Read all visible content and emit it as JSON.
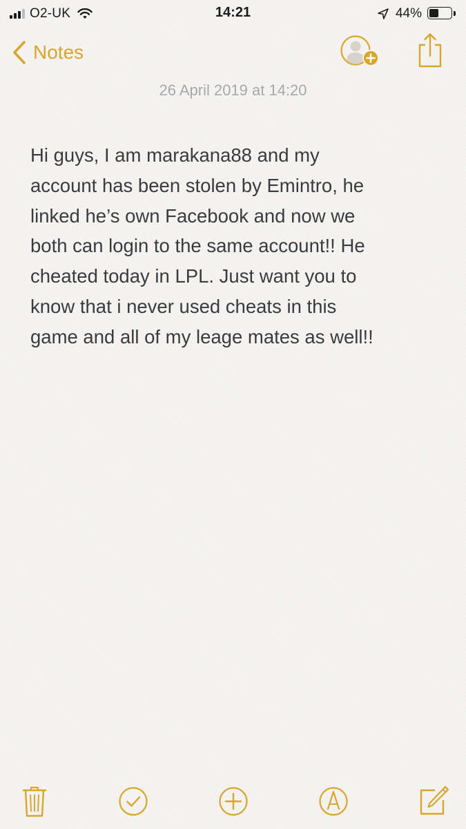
{
  "status_bar": {
    "carrier": "O2-UK",
    "time": "14:21",
    "battery_percent_label": "44%",
    "battery_level": 0.44,
    "icons": [
      "signal-bars-icon",
      "wifi-icon",
      "location-arrow-icon",
      "battery-icon"
    ]
  },
  "nav": {
    "back_label": "Notes",
    "actions": [
      "add-people-icon",
      "share-icon"
    ]
  },
  "note": {
    "date": "26 April 2019 at 14:20",
    "body": "Hi guys, I am marakana88 and my\naccount has been stolen by Emintro, he\nlinked he’s own Facebook and now we\nboth can login to the same account!! He\ncheated today in LPL. Just want you to\nknow that i never used cheats in this\ngame and all of my leage mates as well!!"
  },
  "toolbar": {
    "items": [
      "trash-icon",
      "checklist-icon",
      "add-icon",
      "markup-pen-icon",
      "compose-icon"
    ]
  },
  "colors": {
    "accent": "#d9a52b",
    "background": "#f5f4f2",
    "text": "#3b3b3b",
    "date_text": "#a8a8a8"
  }
}
